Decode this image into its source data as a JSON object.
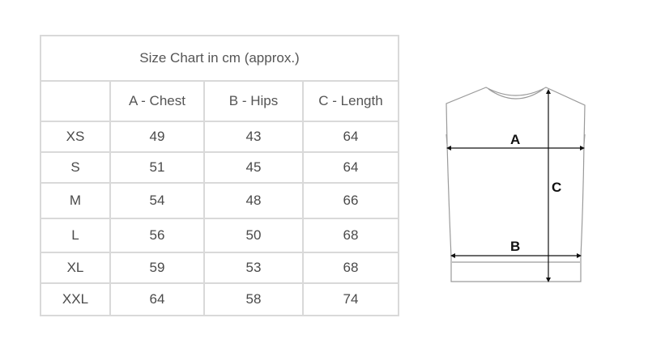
{
  "table": {
    "title": "Size Chart in cm (approx.)",
    "headers": [
      "",
      "A - Chest",
      "B - Hips",
      "C - Length"
    ],
    "rows": [
      {
        "size": "XS",
        "chest": "49",
        "hips": "43",
        "length": "64"
      },
      {
        "size": "S",
        "chest": "51",
        "hips": "45",
        "length": "64"
      },
      {
        "size": "M",
        "chest": "54",
        "hips": "48",
        "length": "66"
      },
      {
        "size": "L",
        "chest": "56",
        "hips": "50",
        "length": "68"
      },
      {
        "size": "XL",
        "chest": "59",
        "hips": "53",
        "length": "68"
      },
      {
        "size": "XXL",
        "chest": "64",
        "hips": "58",
        "length": "74"
      }
    ]
  },
  "diagram": {
    "label_a": "A",
    "label_b": "B",
    "label_c": "C"
  },
  "colors": {
    "grid": "#d9d9d9",
    "text": "#4a4a4a",
    "garment_outline": "#9a9a9a",
    "measure_line": "#111111"
  }
}
